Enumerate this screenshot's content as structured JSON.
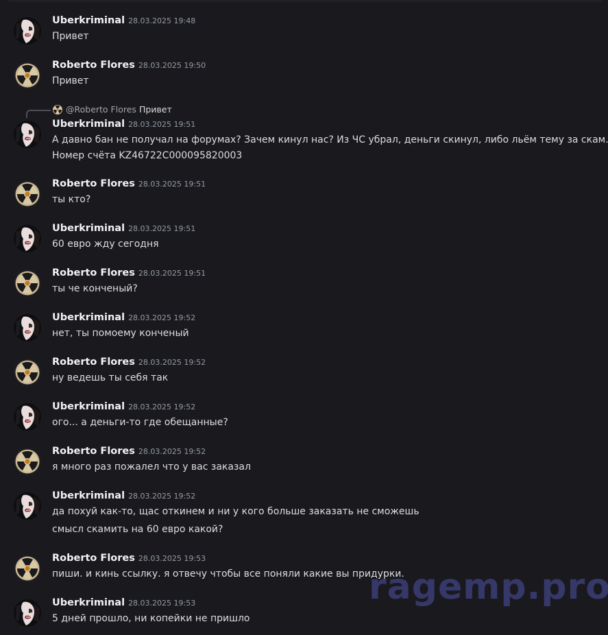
{
  "reply": {
    "mention": "@Roberto Flores",
    "quote": "Привет"
  },
  "messages": [
    {
      "author": "Uberkriminal",
      "avatar": "uber",
      "time": "28.03.2025 19:48",
      "lines": [
        "Привет"
      ]
    },
    {
      "author": "Roberto Flores",
      "avatar": "roberto",
      "time": "28.03.2025 19:50",
      "lines": [
        "Привет"
      ]
    },
    {
      "author": "Uberkriminal",
      "avatar": "uber",
      "time": "28.03.2025 19:51",
      "lines": [
        "А давно бан не получал на форумах? Зачем кинул нас? Из ЧС убрал, деньги скинул, либо льём тему за скам...",
        "Номер счёта KZ46722C000095820003"
      ]
    },
    {
      "author": "Roberto Flores",
      "avatar": "roberto",
      "time": "28.03.2025 19:51",
      "lines": [
        "ты кто?"
      ]
    },
    {
      "author": "Uberkriminal",
      "avatar": "uber",
      "time": "28.03.2025 19:51",
      "lines": [
        "60 евро жду сегодня"
      ]
    },
    {
      "author": "Roberto Flores",
      "avatar": "roberto",
      "time": "28.03.2025 19:51",
      "lines": [
        "ты че конченый?"
      ]
    },
    {
      "author": "Uberkriminal",
      "avatar": "uber",
      "time": "28.03.2025 19:52",
      "lines": [
        "нет, ты помоему конченый"
      ]
    },
    {
      "author": "Roberto Flores",
      "avatar": "roberto",
      "time": "28.03.2025 19:52",
      "lines": [
        "ну ведешь ты себя так"
      ]
    },
    {
      "author": "Uberkriminal",
      "avatar": "uber",
      "time": "28.03.2025 19:52",
      "lines": [
        "ого... а деньги-то где обещанные?"
      ]
    },
    {
      "author": "Roberto Flores",
      "avatar": "roberto",
      "time": "28.03.2025 19:52",
      "lines": [
        "я много раз пожалел что у вас заказал"
      ]
    },
    {
      "author": "Uberkriminal",
      "avatar": "uber",
      "time": "28.03.2025 19:52",
      "lines": [
        "да похуй как-то, щас откинем и ни у кого больше заказать не сможешь",
        "смысл скамить на 60 евро какой?"
      ]
    },
    {
      "author": "Roberto Flores",
      "avatar": "roberto",
      "time": "28.03.2025 19:53",
      "lines": [
        "пиши. и кинь ссылку. я отвечу чтобы все поняли какие вы придурки."
      ]
    },
    {
      "author": "Uberkriminal",
      "avatar": "uber",
      "time": "28.03.2025 19:53",
      "lines": [
        "5 дней прошло, ни копейки не пришло"
      ]
    }
  ],
  "watermark": "ragemp.pro",
  "colors": {
    "background": "#1a1a1e",
    "text": "#dbdee1",
    "username": "#f2f3f5",
    "timestamp": "#949ba4",
    "watermark": "#3c3e78"
  }
}
